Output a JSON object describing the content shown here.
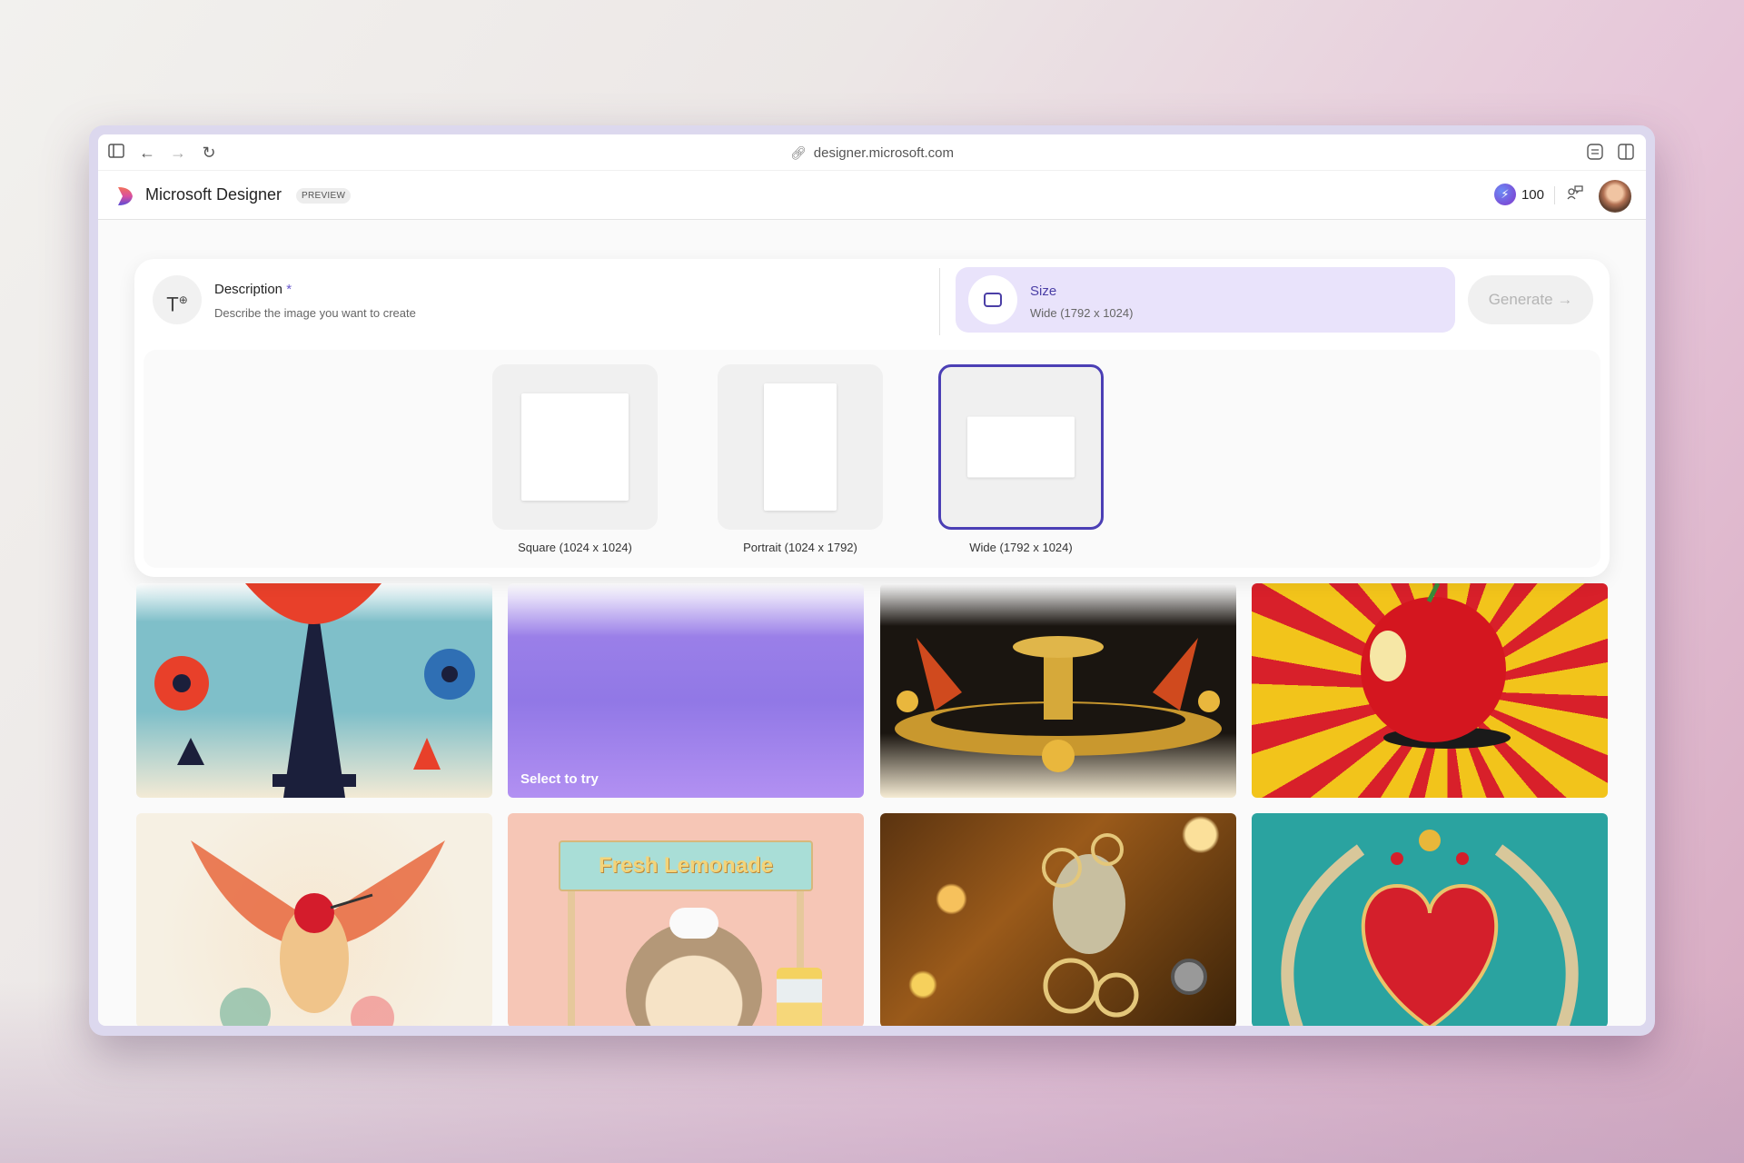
{
  "browser": {
    "url": "designer.microsoft.com",
    "icons": [
      "sidebar-icon",
      "back-arrow-icon",
      "forward-arrow-icon",
      "reload-icon",
      "link-icon",
      "settings-sliders-icon",
      "split-view-icon"
    ]
  },
  "app": {
    "name": "Microsoft Designer",
    "badge": "PREVIEW",
    "credits": "100",
    "credits_icon": "boost-icon"
  },
  "prompt": {
    "description_title": "Description",
    "required_mark": "*",
    "description_placeholder": "Describe the image you want to create",
    "size_title": "Size",
    "size_value": "Wide (1792 x 1024)",
    "generate_label": "Generate",
    "generate_arrow": "→"
  },
  "size_options": [
    {
      "label": "Square (1024 x 1024)",
      "selected": false
    },
    {
      "label": "Portrait (1024 x 1792)",
      "selected": false
    },
    {
      "label": "Wide (1792 x 1024)",
      "selected": true
    }
  ],
  "gallery": {
    "select_label": "Select to try",
    "tiles": [
      {
        "subject": "patriotic statue of liberty with pinwheels"
      },
      {
        "subject": "purple gradient placeholder"
      },
      {
        "subject": "art deco golden fountain"
      },
      {
        "subject": "pop art red cherry"
      },
      {
        "subject": "watercolor hummingbird"
      },
      {
        "subject": "hedgehog lemonade stand",
        "sign_text": "Fresh Lemonade"
      },
      {
        "subject": "steampunk clockwork figure"
      },
      {
        "subject": "embroidered red heart"
      }
    ]
  },
  "colors": {
    "accent": "#4b3fb5",
    "size_bg": "#e9e3fb"
  }
}
